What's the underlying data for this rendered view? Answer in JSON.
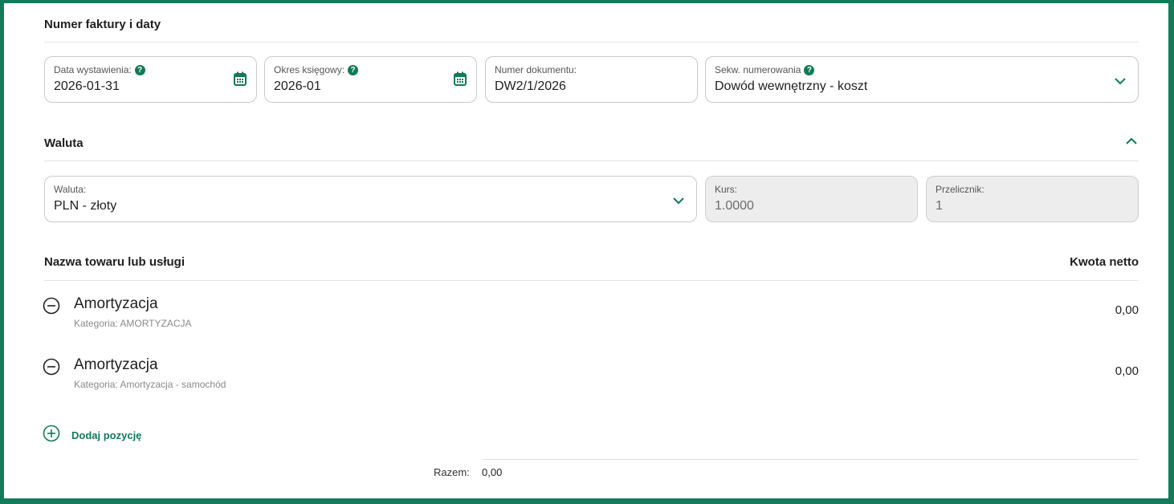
{
  "sections": {
    "invoice_title": "Numer faktury i daty",
    "currency_title": "Waluta",
    "items_column_name": "Nazwa towaru lub usługi",
    "items_column_amount": "Kwota netto"
  },
  "fields": {
    "issue_date": {
      "label": "Data wystawienia:",
      "value": "2026-01-31"
    },
    "accounting_period": {
      "label": "Okres księgowy:",
      "value": "2026-01"
    },
    "document_number": {
      "label": "Numer dokumentu:",
      "value": "DW2/1/2026"
    },
    "numbering_sequence": {
      "label": "Sekw. numerowania",
      "value": "Dowód wewnętrzny - koszt"
    },
    "currency": {
      "label": "Waluta:",
      "value": "PLN - złoty"
    },
    "rate": {
      "label": "Kurs:",
      "value": "1.0000"
    },
    "converter": {
      "label": "Przelicznik:",
      "value": "1"
    }
  },
  "help_glyph": "?",
  "items": [
    {
      "name": "Amortyzacja",
      "category": "Kategoria: AMORTYZACJA",
      "amount": "0,00"
    },
    {
      "name": "Amortyzacja",
      "category": "Kategoria: Amortyzacja - samochód",
      "amount": "0,00"
    }
  ],
  "add_item_label": "Dodaj pozycję",
  "total": {
    "label": "Razem:",
    "value": "0,00"
  },
  "colors": {
    "accent": "#0f7a56",
    "frame": "#147a5a"
  },
  "icons": [
    "calendar-icon",
    "chevron-down-icon",
    "chevron-up-icon",
    "remove-circle-icon",
    "add-circle-icon",
    "help-icon"
  ]
}
